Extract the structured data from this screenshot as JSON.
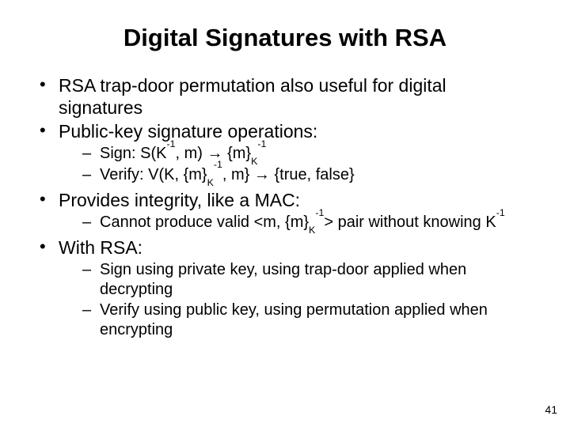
{
  "title": "Digital Signatures with RSA",
  "bullets": {
    "b1": "RSA trap-door permutation also useful for digital signatures",
    "b2": "Public-key signature operations:",
    "b2s1_pre": "Sign: S(K",
    "b2s1_mid1": ", m) ",
    "b2s1_mid2": " {m}",
    "b2s2_pre": "Verify: V(K, {m}",
    "b2s2_mid": ", m} ",
    "b2s2_post": " {true, false}",
    "b3": "Provides integrity, like a MAC:",
    "b3s1_pre": "Cannot produce valid <m, {m}",
    "b3s1_mid": "> pair without knowing K",
    "b4": "With RSA:",
    "b4s1": "Sign using private key, using trap-door applied when decrypting",
    "b4s2": "Verify using public key, using permutation applied when encrypting"
  },
  "sym": {
    "arrow": "→",
    "neg1": "-1",
    "K": "K"
  },
  "pagenum": "41"
}
